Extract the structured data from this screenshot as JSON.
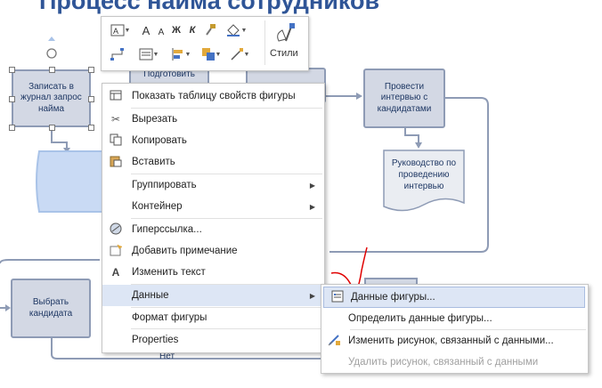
{
  "page": {
    "title": "Процесс найма сотрудников"
  },
  "diagram": {
    "shapes": {
      "record_request": "Записать в журнал запрос найма",
      "prepare": "Подготовить",
      "interview": "Провести интервью с кандидатами",
      "guide": "Руководство по проведению интервью",
      "select": "Выбрать кандидата"
    },
    "no_label": "Нет"
  },
  "toolbar": {
    "styles_label": "Стили",
    "bold": "Ж",
    "italic": "К",
    "font_grow": "A",
    "font_shrink": "A"
  },
  "menu": {
    "items": [
      {
        "label": "Показать таблицу свойств фигуры",
        "icon": "table-icon"
      },
      {
        "label": "Вырезать",
        "icon": "scissors-icon"
      },
      {
        "label": "Копировать",
        "icon": "copy-icon"
      },
      {
        "label": "Вставить",
        "icon": "paste-icon"
      },
      {
        "label": "Группировать",
        "icon": "",
        "submenu": true
      },
      {
        "label": "Контейнер",
        "icon": "",
        "submenu": true
      },
      {
        "label": "Гиперссылка...",
        "icon": "hyperlink-icon"
      },
      {
        "label": "Добавить примечание",
        "icon": "comment-icon"
      },
      {
        "label": "Изменить текст",
        "icon": "text-icon"
      },
      {
        "label": "Данные",
        "icon": "",
        "submenu": true,
        "highlighted": true
      },
      {
        "label": "Формат фигуры",
        "icon": ""
      },
      {
        "label": "Properties",
        "icon": ""
      }
    ]
  },
  "submenu": {
    "items": [
      {
        "label": "Данные фигуры...",
        "icon": "shape-data-icon",
        "highlighted": true
      },
      {
        "label": "Определить данные фигуры...",
        "icon": ""
      },
      {
        "label": "Изменить рисунок, связанный с данными...",
        "icon": "edit-graphic-icon"
      },
      {
        "label": "Удалить рисунок, связанный с данными",
        "icon": "",
        "disabled": true
      }
    ]
  },
  "colors": {
    "title": "#2f5597",
    "shape_fill": "#d3d8e4",
    "shape_border": "#8e9bb5",
    "connector": "#8e9bb5",
    "highlight": "#dde6f5",
    "annotation": "#e00000"
  }
}
